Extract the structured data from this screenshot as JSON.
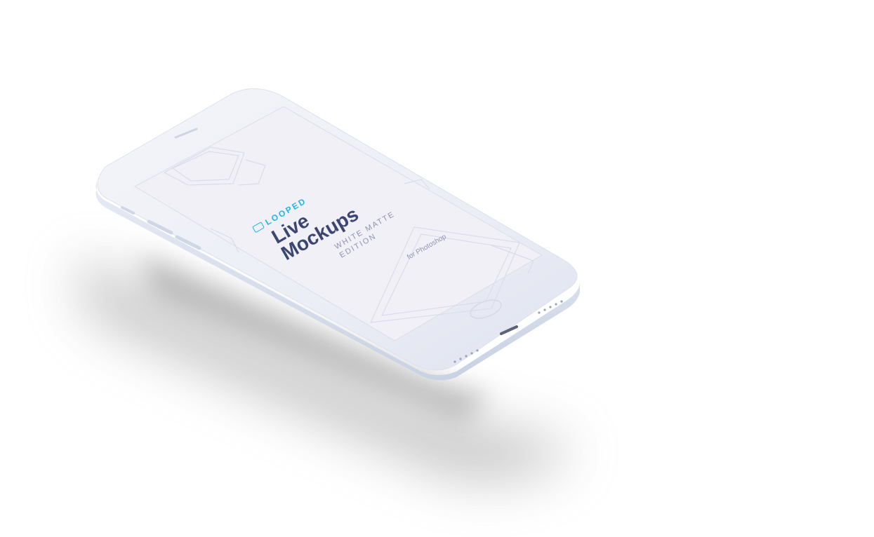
{
  "scene": {
    "background_color": "#ffffff",
    "device_color": "#eef0f7",
    "screen_color": "#f0eff7"
  },
  "screen": {
    "brand_name": "LOOPED",
    "brand_color": "#23b4e8",
    "title_line1": "Live",
    "title_line2": "Mockups",
    "edition_line1": "WHITE MATTE",
    "edition_line2": "EDITION",
    "platform": "for Photoshop"
  }
}
